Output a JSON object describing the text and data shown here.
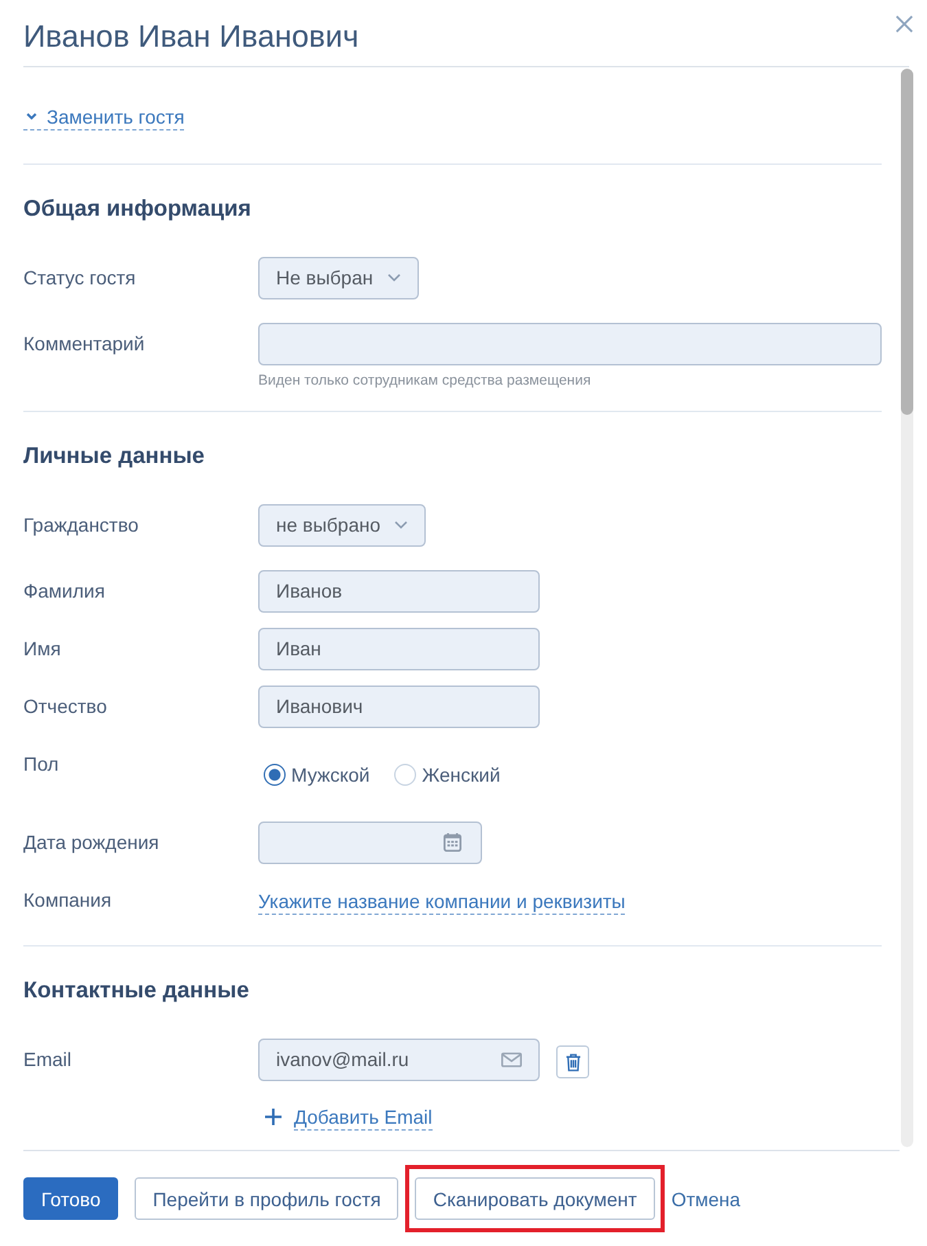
{
  "dialog": {
    "title": "Иванов Иван Иванович"
  },
  "replace_guest_link": {
    "label": "Заменить гостя"
  },
  "sections": [
    {
      "heading": "Общая информация",
      "fields": [
        {
          "kind": "select",
          "label": "Статус гостя",
          "value": "Не выбран"
        },
        {
          "kind": "comment",
          "label": "Комментарий",
          "hint": "Виден только сотрудникам средства размещения"
        }
      ]
    },
    {
      "heading": "Личные данные",
      "fields": [
        {
          "kind": "select",
          "label": "Гражданство",
          "value": "не выбрано"
        },
        {
          "kind": "text",
          "label": "Фамилия",
          "value": "Иванов"
        },
        {
          "kind": "text",
          "label": "Имя",
          "value": "Иван"
        },
        {
          "kind": "text",
          "label": "Отчество",
          "value": "Иванович"
        },
        {
          "kind": "radio",
          "label": "Пол",
          "options": [
            {
              "label": "Мужской",
              "selected": true
            },
            {
              "label": "Женский",
              "selected": false
            }
          ]
        },
        {
          "kind": "date",
          "label": "Дата рождения"
        },
        {
          "kind": "link",
          "label": "Компания",
          "value": "Укажите название компании и реквизиты"
        }
      ]
    },
    {
      "heading": "Контактные данные",
      "fields": [
        {
          "kind": "email",
          "label": "Email",
          "value": "ivanov@mail.ru"
        }
      ],
      "add_link": "Добавить Email"
    }
  ],
  "footer": {
    "buttons": [
      {
        "kind": "primary",
        "label": "Готово",
        "highlighted": false
      },
      {
        "kind": "secondary",
        "label": "Перейти в профиль гостя",
        "highlighted": false
      },
      {
        "kind": "secondary",
        "label": "Сканировать документ",
        "highlighted": true
      },
      {
        "kind": "link",
        "label": "Отмена",
        "highlighted": false
      }
    ]
  }
}
